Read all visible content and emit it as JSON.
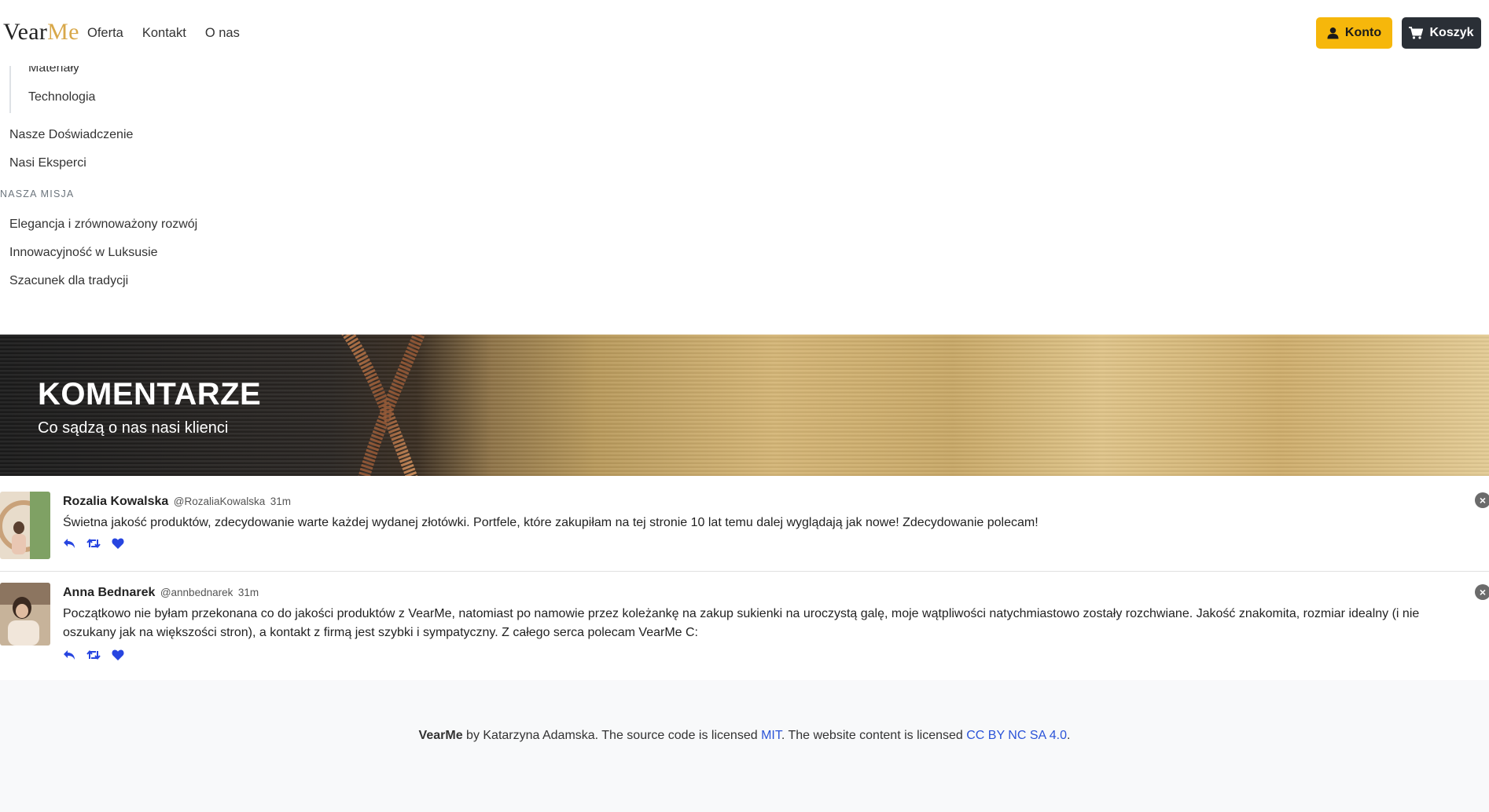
{
  "navbar": {
    "brand_part1": "Vear",
    "brand_part2": "Me",
    "links": [
      "Oferta",
      "Kontakt",
      "O nas"
    ],
    "account_label": "Konto",
    "cart_label": "Koszyk",
    "colors": {
      "account_button": "#f6b70b",
      "cart_button": "#2a2f36",
      "brand_accent": "#d8a84a"
    }
  },
  "sidebar": {
    "partial_item": "Materiały",
    "sub_item": "Technologia",
    "items": [
      "Nasze Doświadczenie",
      "Nasi Eksperci"
    ],
    "mission_heading": "NASZA MISJA",
    "mission_items": [
      "Elegancja i zrównoważony rozwój",
      "Innowacyjność w Luksusie",
      "Szacunek dla tradycji"
    ]
  },
  "hero": {
    "title": "KOMENTARZE",
    "subtitle": "Co sądzą o nas nasi klienci"
  },
  "comments": [
    {
      "name": "Rozalia Kowalska",
      "handle": "@RozaliaKowalska",
      "time": "31m",
      "text": "Świetna jakość produktów, zdecydowanie warte każdej wydanej złotówki. Portfele, które zakupiłam na tej stronie 10 lat temu dalej wyglądają jak nowe! Zdecydowanie polecam!"
    },
    {
      "name": "Anna Bednarek",
      "handle": "@annbednarek",
      "time": "31m",
      "text": "Początkowo nie byłam przekonana co do jakości produktów z VearMe, natomiast po namowie przez koleżankę na zakup sukienki na uroczystą galę, moje wątpliwości natychmiastowo zostały rozchwiane. Jakość znakomita, rozmiar idealny (i nie oszukany jak na większości stron), a kontakt z firmą jest szybki i sympatyczny. Z całego serca polecam VearMe C:"
    }
  ],
  "comment_icons": [
    "reply-icon",
    "retweet-icon",
    "heart-icon",
    "close-icon"
  ],
  "footer": {
    "brand": "VearMe",
    "by_text": " by Katarzyna Adamska. The source code is licensed ",
    "mit_link": "MIT",
    "content_text": ". The website content is licensed ",
    "cc_link": "CC BY NC SA 4.0",
    "end": "."
  }
}
